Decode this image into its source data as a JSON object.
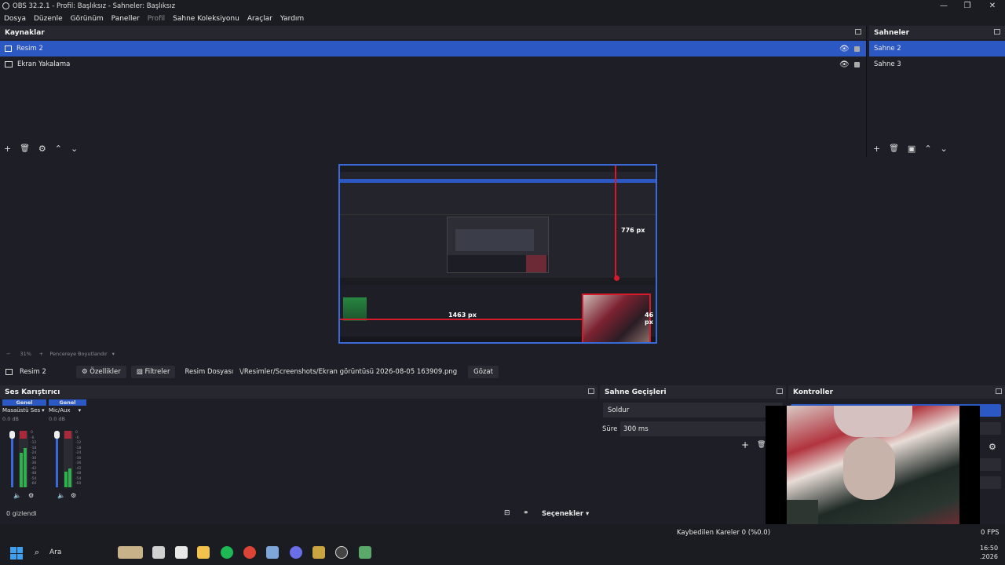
{
  "window": {
    "title": "OBS 32.2.1 - Profil: Başlıksız - Sahneler: Başlıksız",
    "minimize": "—",
    "maximize": "❐",
    "close": "✕"
  },
  "menu": {
    "items": [
      "Dosya",
      "Düzenle",
      "Görünüm",
      "Paneller",
      "Profil",
      "Sahne Koleksiyonu",
      "Araçlar",
      "Yardım"
    ]
  },
  "sources": {
    "title": "Kaynaklar",
    "items": [
      {
        "label": "Resim 2",
        "selected": true
      },
      {
        "label": "Ekran Yakalama",
        "selected": false
      }
    ]
  },
  "scenes": {
    "title": "Sahneler",
    "items": [
      {
        "label": "Sahne 2",
        "selected": true
      },
      {
        "label": "Sahne 3",
        "selected": false
      }
    ]
  },
  "preview": {
    "measure_top": "776 px",
    "measure_left": "1463 px",
    "measure_right": "46 px",
    "zoom": "31%",
    "fit_label": "Pencereye Boyutlandır"
  },
  "properties_bar": {
    "source_name": "Resim 2",
    "properties_label": "Özellikler",
    "filters_label": "Filtreler",
    "file_label": "Resim Dosyası",
    "file_path": "\\/Resimler/Screenshots/Ekran görüntüsü 2026-08-05 163909.png",
    "browse_label": "Gözat"
  },
  "mixer": {
    "title": "Ses Karıştırıcı",
    "channels": [
      {
        "group": "Genel",
        "name": "Masaüstü Ses",
        "db": "0.0 dB"
      },
      {
        "group": "Genel",
        "name": "Mic/Aux",
        "db": "0.0 dB"
      }
    ],
    "scale": [
      "0",
      "-6",
      "-12",
      "-18",
      "-24",
      "-30",
      "-36",
      "-42",
      "-48",
      "-54",
      "-60"
    ],
    "hidden_text": "0 gizlendi",
    "options_label": "Seçenekler"
  },
  "transitions": {
    "title": "Sahne Geçişleri",
    "selected": "Soldur",
    "duration_label": "Süre",
    "duration_value": "300 ms"
  },
  "controls": {
    "title": "Kontroller"
  },
  "status": {
    "dropped": "Kaybedilen Kareler 0 (%0.0)",
    "fps": "0 FPS"
  },
  "taskbar": {
    "search_label": "Ara",
    "time": "16:50",
    "date": ".2026"
  },
  "colors": {
    "accent": "#2c58c4",
    "red_guide": "#d41b2c",
    "meter_green": "#2bb24c"
  }
}
